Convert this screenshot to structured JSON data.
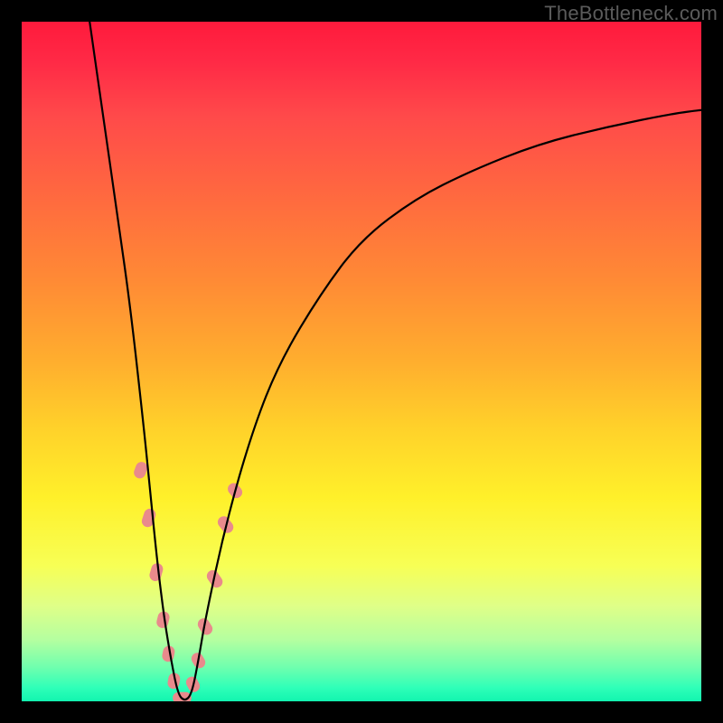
{
  "watermark": {
    "text": "TheBottleneck.com"
  },
  "colors": {
    "background": "#000000",
    "gradient_top": "#ff1a3c",
    "gradient_bottom": "#12f5af",
    "curve": "#000000",
    "marker": "#e98a8c"
  },
  "chart_data": {
    "type": "line",
    "title": "",
    "xlabel": "",
    "ylabel": "",
    "xlim": [
      0,
      100
    ],
    "ylim": [
      0,
      100
    ],
    "grid": false,
    "legend": false,
    "note": "Bottleneck-style V-curve on rainbow gradient. No axes or numeric labels are shown; x and y values are estimated from pixel positions on a 0–100 normalized scale (origin bottom-left).",
    "series": [
      {
        "name": "curve",
        "x": [
          10,
          12,
          14,
          16,
          18,
          19,
          20,
          21,
          22,
          23,
          24,
          25,
          26,
          27,
          30,
          34,
          38,
          44,
          50,
          58,
          66,
          76,
          86,
          96,
          100
        ],
        "y": [
          100,
          86,
          72,
          58,
          40,
          30,
          20,
          12,
          6,
          1,
          0,
          1,
          6,
          12,
          26,
          40,
          50,
          60,
          68,
          74,
          78,
          82,
          84.5,
          86.5,
          87
        ]
      }
    ],
    "markers": {
      "note": "Salmon capsule-shaped markers clustered along the lower portion of both arms of the V.",
      "points": [
        {
          "x": 17.5,
          "y": 34,
          "len": 6,
          "angle": -70
        },
        {
          "x": 18.7,
          "y": 27,
          "len": 9,
          "angle": -72
        },
        {
          "x": 19.8,
          "y": 19,
          "len": 8,
          "angle": -74
        },
        {
          "x": 20.8,
          "y": 12,
          "len": 6,
          "angle": -76
        },
        {
          "x": 21.6,
          "y": 7,
          "len": 5,
          "angle": -78
        },
        {
          "x": 22.4,
          "y": 3,
          "len": 5,
          "angle": -80
        },
        {
          "x": 23.6,
          "y": 0.5,
          "len": 9,
          "angle": 0
        },
        {
          "x": 25.2,
          "y": 2.5,
          "len": 5,
          "angle": 62
        },
        {
          "x": 26.0,
          "y": 6,
          "len": 5,
          "angle": 60
        },
        {
          "x": 27.0,
          "y": 11,
          "len": 7,
          "angle": 58
        },
        {
          "x": 28.4,
          "y": 18,
          "len": 9,
          "angle": 55
        },
        {
          "x": 30.0,
          "y": 26,
          "len": 8,
          "angle": 52
        },
        {
          "x": 31.4,
          "y": 31,
          "len": 5,
          "angle": 50
        }
      ]
    }
  }
}
